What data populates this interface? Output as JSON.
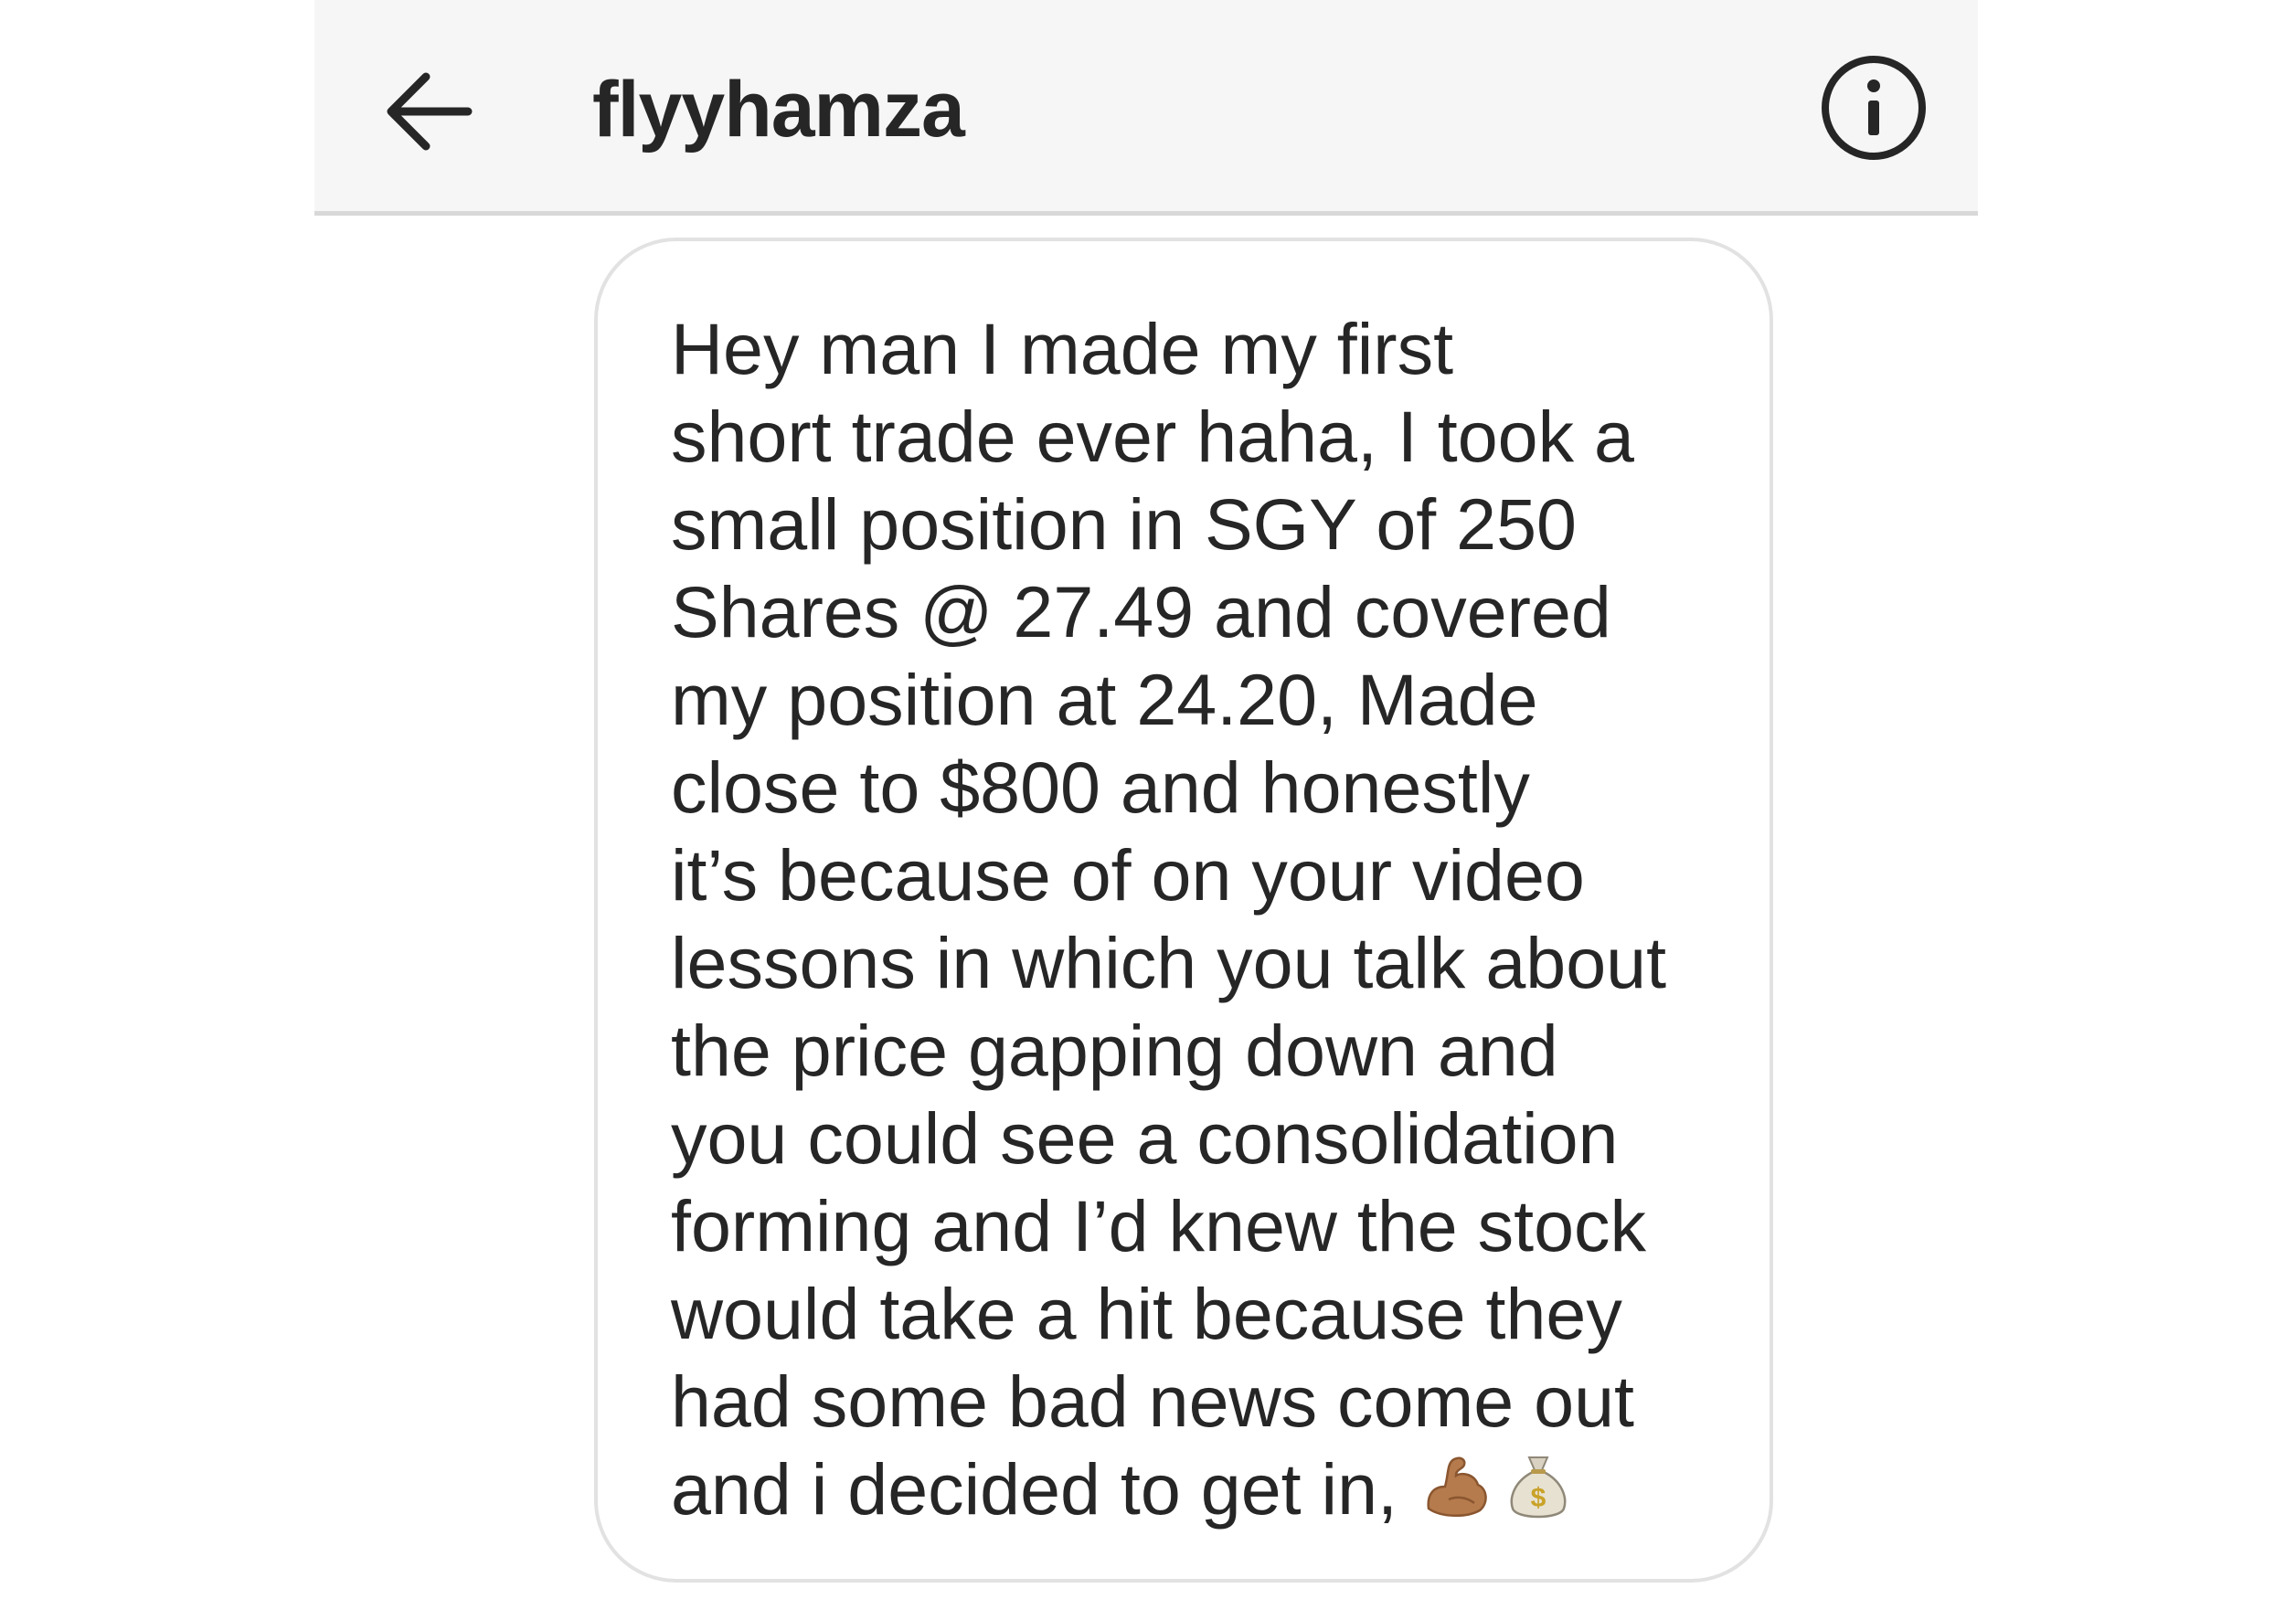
{
  "header": {
    "back_icon": "arrow-left-icon",
    "username": "flyyhamza",
    "info_icon": "info-circle-icon"
  },
  "message": {
    "text": "Hey man I made my first\nshort trade ever haha, I took a\nsmall position in SGY of 250\nShares @ 27.49 and covered\nmy position at 24.20, Made\nclose to $800 and honestly\nit’s because of on your video\nlessons in which you talk about\nthe price gapping down and\nyou could see a consolidation\nforming and I’d knew the stock\nwould take a hit because they\nhad some bad news come out\nand i decided to get in,",
    "emojis": [
      "flexed-biceps-icon",
      "money-bag-icon"
    ]
  }
}
